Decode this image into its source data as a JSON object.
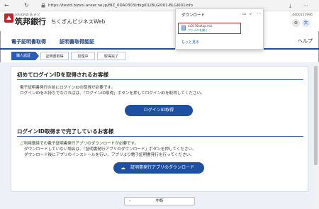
{
  "browser": {
    "url": "https://testd.bizsol.anser.ne.jp/BIZ_0DA0303/rbigi01/BLGI001-BLGI001Info",
    "back_icon": "arrow-left-icon",
    "refresh_icon": "refresh-icon"
  },
  "header": {
    "bank_small": "おもわれの あ き ど",
    "bank_name": "筑邦銀行",
    "service_name": "ちくぎんビジネスWeb",
    "right_id": "_4400121996",
    "avatar_label": "大"
  },
  "tabs": {
    "items": [
      "電子証明書取得",
      "証明書取得認証"
    ],
    "help": "ヘルプ"
  },
  "steps": [
    "職人認証",
    "証明書取得",
    "処理中",
    "取得完了"
  ],
  "section1": {
    "title": "初めてログインIDを取得されるお客様",
    "line1": "電子証明書発行の前にログインIDの取得が必要です。",
    "line2": "ログインIDをお持ちでなければは、「ログインID取得」ボタンを押してログインIDを取得してください。",
    "button": "ログインID取得"
  },
  "section2": {
    "title": "ログインID取得まで完了しているお客様",
    "line1": "ご利用環境での電子証明書発行アプリのダウンロードが必要です。",
    "line2": "ダウンロードしていない場合は、「証明書発行アプリのダウンロード」ボタンを押してください。",
    "line3": "ダウンロード後にアプリのインストールを行い、アプリより電子証明書発行を行ってください。",
    "button": "証明書発行アプリのダウンロード"
  },
  "bottom": {
    "button": "中断"
  },
  "downloads": {
    "title": "ダウンロード",
    "file_name": "cc0176setup.msi",
    "file_link": "ファイルを開く",
    "more": "もっと見る"
  },
  "colors": {
    "primary": "#1f4fa0",
    "highlight": "#e02020",
    "panel_bg": "#edf0f6"
  }
}
